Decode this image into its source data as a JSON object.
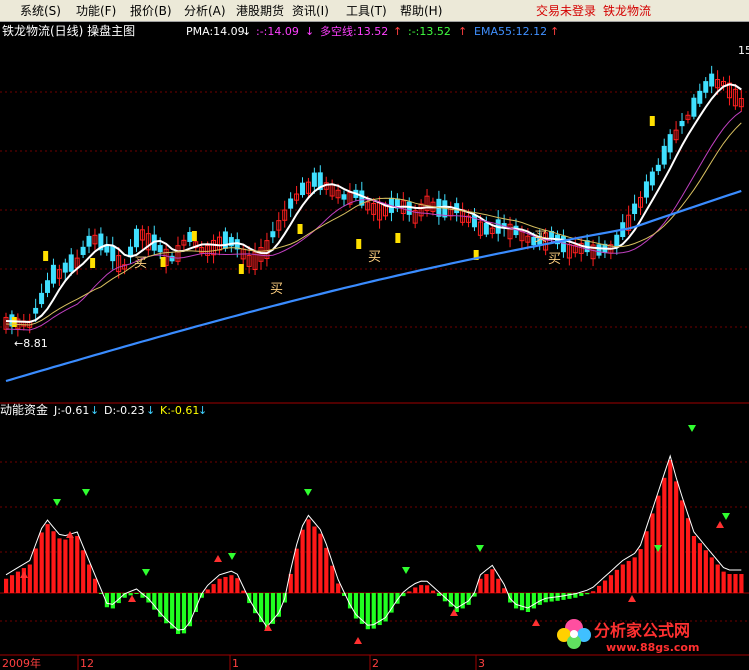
{
  "menu": {
    "items": [
      "系统(S)",
      "功能(F)",
      "报价(B)",
      "分析(A)",
      "港股期货",
      "资讯(I)",
      "工具(T)",
      "帮助(H)"
    ],
    "login_status": "交易未登录",
    "stock": "铁龙物流"
  },
  "main_panel": {
    "title": "铁龙物流(日线) 操盘主图",
    "indicators": [
      {
        "label": "PMA:14.09",
        "arrow": "down",
        "color": "#ffffff"
      },
      {
        "label": ":-:14.09",
        "arrow": "down",
        "color": "#ff40ff"
      },
      {
        "label": "多空线:13.52",
        "arrow": "up",
        "color": "#ff40ff"
      },
      {
        "label": ":-:13.52",
        "arrow": "up",
        "color": "#40ff40"
      },
      {
        "label": "EMA55:12.12",
        "arrow": "up",
        "color": "#4090ff"
      }
    ],
    "low_marker": "←8.81",
    "high_marker": "15",
    "buy_label": "买"
  },
  "sub_panel": {
    "title": "动能资金",
    "indicators": [
      {
        "label": "J:-0.61",
        "arrow": "down",
        "color": "#ffffff"
      },
      {
        "label": "D:-0.23",
        "arrow": "down",
        "color": "#ffffff"
      },
      {
        "label": "K:-0.61",
        "arrow": "down",
        "color": "#ffff00"
      }
    ]
  },
  "time_axis": {
    "labels": [
      "2009年",
      "12",
      "1",
      "2",
      "3"
    ]
  },
  "watermark": {
    "name": "分析家公式网",
    "url": "www.88gs.com"
  },
  "colors": {
    "up": "#ff2020",
    "down": "#40e0ff",
    "hist_up": "#ff1818",
    "hist_down": "#20ff20",
    "ema": "#3a8cff",
    "pma": "#ffffff",
    "duokong": "#c040c0",
    "yellow": "#ffe000"
  }
}
